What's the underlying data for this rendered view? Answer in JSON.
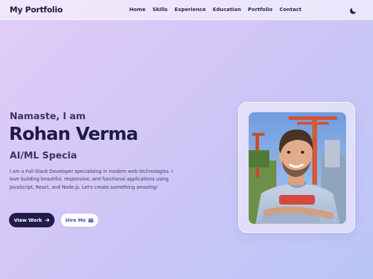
{
  "navbar": {
    "brand": "My Portfolio",
    "links": [
      {
        "label": "Home"
      },
      {
        "label": "Skills"
      },
      {
        "label": "Experience"
      },
      {
        "label": "Education"
      },
      {
        "label": "Portfolio"
      },
      {
        "label": "Contact"
      }
    ],
    "theme_toggle_icon": "moon-icon"
  },
  "hero": {
    "greeting": "Namaste, I am",
    "name": "Rohan Verma",
    "role": "AI/ML Specia",
    "description": "I am a Full-Stack Developer specializing in modern web technologies. I love building beautiful, responsive, and functional applications using JavaScript, React, and Node.js. Let's create something amazing!",
    "buttons": {
      "view_work": {
        "label": "View Work",
        "icon": "arrow-right-icon"
      },
      "hire_me": {
        "label": "Hire Me",
        "icon": "envelope-icon"
      }
    },
    "photo": {
      "icon": "profile-photo"
    }
  },
  "colors": {
    "accent_dark": "#1f1c4d",
    "accent_blue": "#4a55c4",
    "background_start": "#e2cdf7",
    "background_end": "#b9c6f6"
  }
}
